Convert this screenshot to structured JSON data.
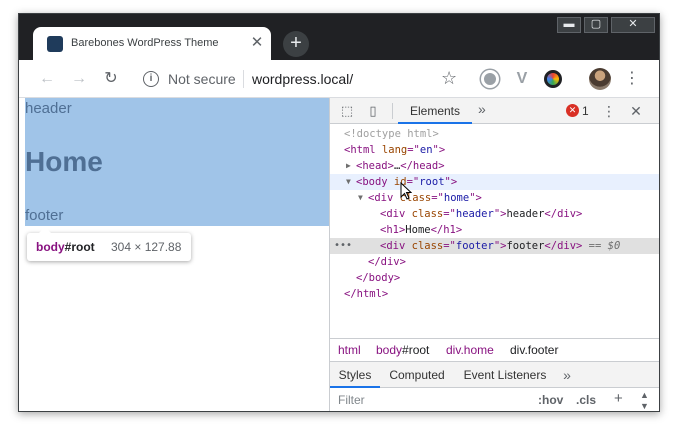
{
  "browser": {
    "tab": {
      "title": "Barebones WordPress Theme",
      "favicon": "react-favicon-icon",
      "close_glyph": "✕"
    },
    "new_tab_glyph": "+",
    "window_controls": {
      "minimize": "▬",
      "maximize": "▢",
      "close": "✕"
    },
    "toolbar": {
      "back_glyph": "←",
      "forward_glyph": "→",
      "reload_glyph": "↻",
      "info_glyph": "i",
      "security_label": "Not secure",
      "url": "wordpress.local/",
      "star_glyph": "☆",
      "ext_v_glyph": "V",
      "menu_glyph": "⋮"
    }
  },
  "page": {
    "header_text": "header",
    "title_text": "Home",
    "footer_text": "footer",
    "highlight_color": "#a0c4e8",
    "tooltip": {
      "tag": "body",
      "id": "#root",
      "size": "304 × 127.88"
    }
  },
  "devtools": {
    "toolbar": {
      "inspect_glyph": "⬚",
      "device_glyph": "▯",
      "active_tab": "Elements",
      "more_glyph": "»",
      "error_glyph": "✕",
      "error_count": "1",
      "kebab_glyph": "⋮",
      "close_glyph": "✕"
    },
    "dom": {
      "doctype": "<!doctype html>",
      "html_open": {
        "tag": "<html",
        "attr": " lang",
        "eq": "=\"",
        "val": "en",
        "close": "\">"
      },
      "head": {
        "tri": "▶",
        "tag_open": "<head>",
        "ellipsis": "…",
        "tag_close": "</head>"
      },
      "body_open": {
        "tri": "▼",
        "tag": "<body",
        "attr": " id",
        "eq": "=\"",
        "val": "root",
        "close": "\">"
      },
      "div_home": {
        "tri": "▼",
        "tag": "<div",
        "attr": " class",
        "eq": "=\"",
        "val": "home",
        "close": "\">"
      },
      "div_header": {
        "tag": "<div",
        "attr": " class",
        "eq": "=\"",
        "val": "header",
        "close": "\">",
        "text": "header",
        "end": "</div>"
      },
      "h1": {
        "tag": "<h1>",
        "text": "Home",
        "end": "</h1>"
      },
      "div_footer": {
        "dots": "•••",
        "tag": "<div",
        "attr": " class",
        "eq": "=\"",
        "val": "footer",
        "close": "\">",
        "text": "footer",
        "end": "</div>",
        "ref": " == $0"
      },
      "div_close": "</div>",
      "body_close": "</body>",
      "html_close": "</html>"
    },
    "breadcrumbs": {
      "html": "html",
      "body_tag": "body",
      "body_id": "#root",
      "home": "div.home",
      "footer": "div.footer"
    },
    "styles_tabs": [
      "Styles",
      "Computed",
      "Event Listeners"
    ],
    "styles_more_glyph": "»",
    "filter": {
      "placeholder": "Filter",
      "hov": ":hov",
      "cls": ".cls",
      "plus": "+",
      "up": "▲",
      "down": "▼"
    }
  },
  "colors": {
    "accent": "#1a73e8",
    "tag": "#881280",
    "attr": "#994500",
    "value": "#1a1aa6"
  }
}
